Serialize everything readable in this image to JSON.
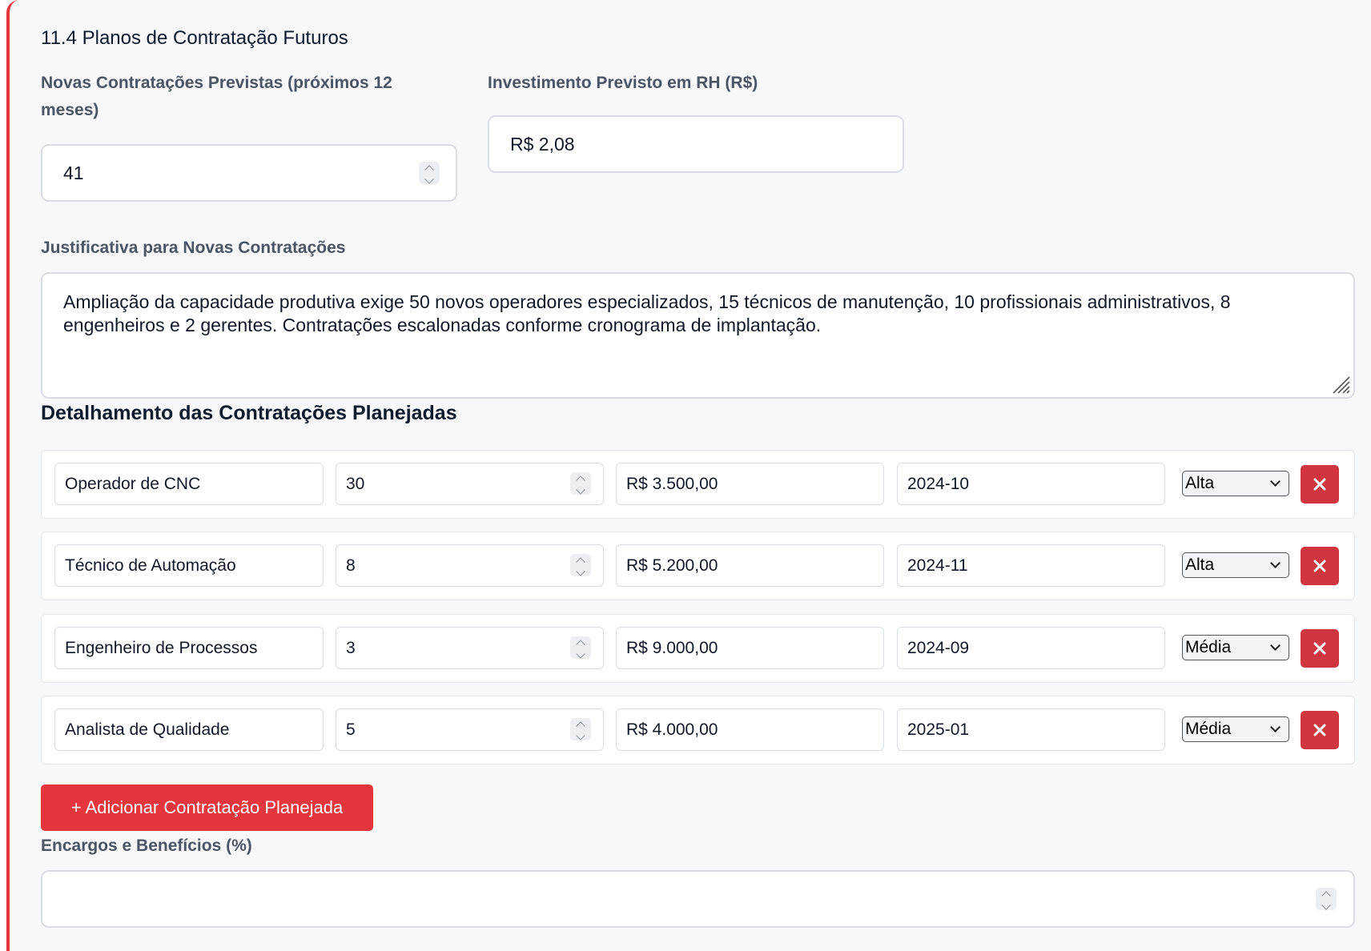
{
  "section": {
    "title": "11.4 Planos de Contratação Futuros"
  },
  "new_hires": {
    "label": "Novas Contratações Previstas (próximos 12 meses)",
    "value": "41"
  },
  "investment": {
    "label": "Investimento Previsto em RH (R$)",
    "value": "R$ 2,08"
  },
  "justification": {
    "label": "Justificativa para Novas Contratações",
    "value": "Ampliação da capacidade produtiva exige 50 novos operadores especializados, 15 técnicos de manutenção, 10 profissionais administrativos, 8 engenheiros e 2 gerentes. Contratações escalonadas conforme cronograma de implantação."
  },
  "planned": {
    "title": "Detalhamento das Contratações Planejadas",
    "rows": [
      {
        "role": "Operador de CNC",
        "qty": "30",
        "salary": "R$ 3.500,00",
        "month": "2024-10",
        "priority": "Alta"
      },
      {
        "role": "Técnico de Automação",
        "qty": "8",
        "salary": "R$ 5.200,00",
        "month": "2024-11",
        "priority": "Alta"
      },
      {
        "role": "Engenheiro de Processos",
        "qty": "3",
        "salary": "R$ 9.000,00",
        "month": "2024-09",
        "priority": "Média"
      },
      {
        "role": "Analista de Qualidade",
        "qty": "5",
        "salary": "R$ 4.000,00",
        "month": "2025-01",
        "priority": "Média"
      }
    ],
    "add_label": "+ Adicionar Contratação Planejada"
  },
  "charges": {
    "label": "Encargos e Benefícios (%)",
    "value": ""
  },
  "colors": {
    "accent": "#e5363d",
    "delete": "#d0363f"
  }
}
